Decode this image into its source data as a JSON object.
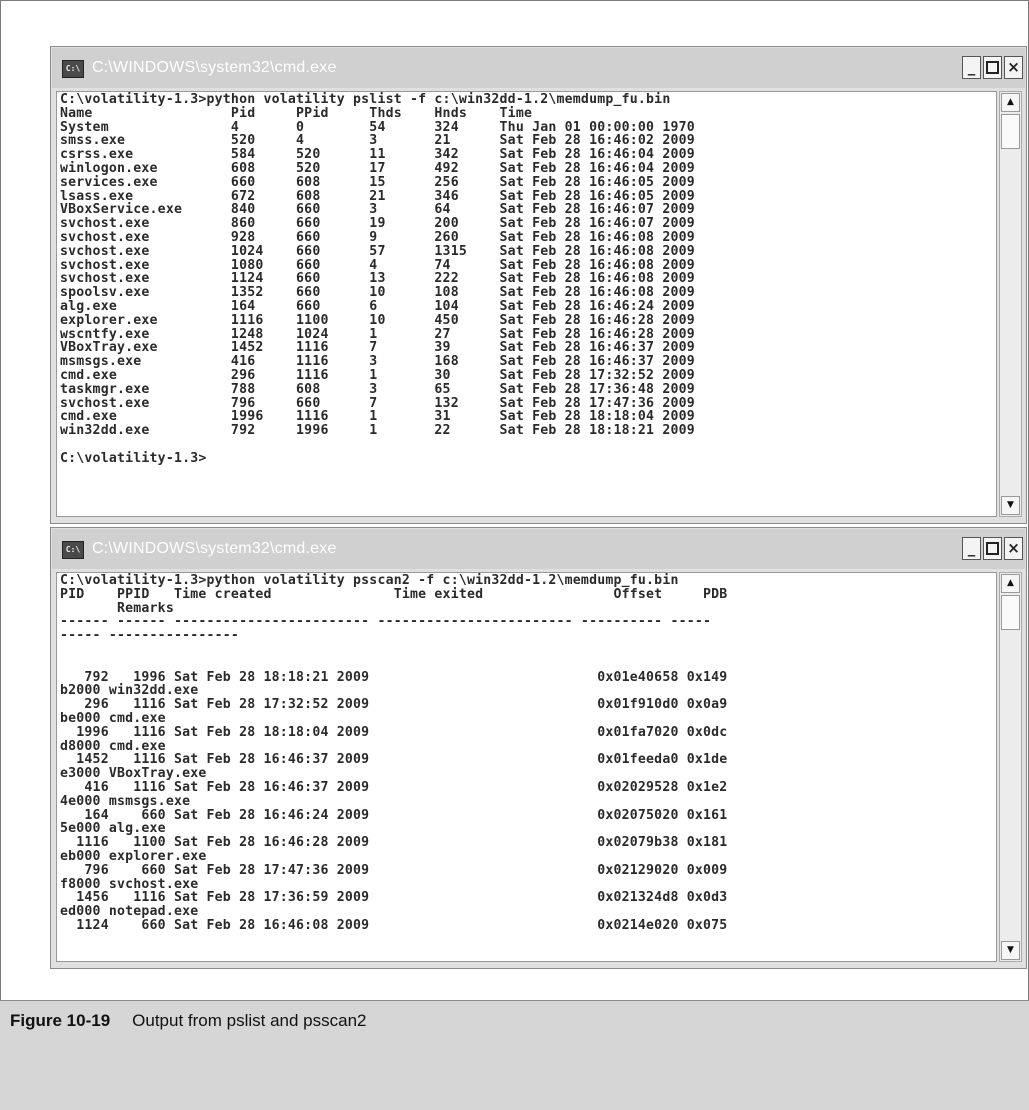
{
  "window1": {
    "title": "C:\\WINDOWS\\system32\\cmd.exe",
    "icon": "console-icon",
    "buttons": {
      "minimize": "_",
      "maximize": "□",
      "close": "×"
    },
    "output": "C:\\volatility-1.3>python volatility pslist -f c:\\win32dd-1.2\\memdump_fu.bin\nName                 Pid     PPid     Thds    Hnds    Time\nSystem               4       0        54      324     Thu Jan 01 00:00:00 1970\nsmss.exe             520     4        3       21      Sat Feb 28 16:46:02 2009\ncsrss.exe            584     520      11      342     Sat Feb 28 16:46:04 2009\nwinlogon.exe         608     520      17      492     Sat Feb 28 16:46:04 2009\nservices.exe         660     608      15      256     Sat Feb 28 16:46:05 2009\nlsass.exe            672     608      21      346     Sat Feb 28 16:46:05 2009\nVBoxService.exe      840     660      3       64      Sat Feb 28 16:46:07 2009\nsvchost.exe          860     660      19      200     Sat Feb 28 16:46:07 2009\nsvchost.exe          928     660      9       260     Sat Feb 28 16:46:08 2009\nsvchost.exe          1024    660      57      1315    Sat Feb 28 16:46:08 2009\nsvchost.exe          1080    660      4       74      Sat Feb 28 16:46:08 2009\nsvchost.exe          1124    660      13      222     Sat Feb 28 16:46:08 2009\nspoolsv.exe          1352    660      10      108     Sat Feb 28 16:46:08 2009\nalg.exe              164     660      6       104     Sat Feb 28 16:46:24 2009\nexplorer.exe         1116    1100     10      450     Sat Feb 28 16:46:28 2009\nwscntfy.exe          1248    1024     1       27      Sat Feb 28 16:46:28 2009\nVBoxTray.exe         1452    1116     7       39      Sat Feb 28 16:46:37 2009\nmsmsgs.exe           416     1116     3       168     Sat Feb 28 16:46:37 2009\ncmd.exe              296     1116     1       30      Sat Feb 28 17:32:52 2009\ntaskmgr.exe          788     608      3       65      Sat Feb 28 17:36:48 2009\nsvchost.exe          796     660      7       132     Sat Feb 28 17:47:36 2009\ncmd.exe              1996    1116     1       31      Sat Feb 28 18:18:04 2009\nwin32dd.exe          792     1996     1       22      Sat Feb 28 18:18:21 2009\n\nC:\\volatility-1.3>"
  },
  "window2": {
    "title": "C:\\WINDOWS\\system32\\cmd.exe",
    "icon": "console-icon",
    "buttons": {
      "minimize": "_",
      "maximize": "□",
      "close": "×"
    },
    "output": "C:\\volatility-1.3>python volatility psscan2 -f c:\\win32dd-1.2\\memdump_fu.bin\nPID    PPID   Time created               Time exited                Offset     PDB\n       Remarks\n------ ------ ------------------------ ------------------------ ---------- -----\n----- ----------------\n\n\n   792   1996 Sat Feb 28 18:18:21 2009                            0x01e40658 0x149\nb2000 win32dd.exe\n   296   1116 Sat Feb 28 17:32:52 2009                            0x01f910d0 0x0a9\nbe000 cmd.exe\n  1996   1116 Sat Feb 28 18:18:04 2009                            0x01fa7020 0x0dc\nd8000 cmd.exe\n  1452   1116 Sat Feb 28 16:46:37 2009                            0x01feeda0 0x1de\ne3000 VBoxTray.exe\n   416   1116 Sat Feb 28 16:46:37 2009                            0x02029528 0x1e2\n4e000 msmsgs.exe\n   164    660 Sat Feb 28 16:46:24 2009                            0x02075020 0x161\n5e000 alg.exe\n  1116   1100 Sat Feb 28 16:46:28 2009                            0x02079b38 0x181\neb000 explorer.exe\n   796    660 Sat Feb 28 17:47:36 2009                            0x02129020 0x009\nf8000 svchost.exe\n  1456   1116 Sat Feb 28 17:36:59 2009                            0x021324d8 0x0d3\ned000 notepad.exe\n  1124    660 Sat Feb 28 16:46:08 2009                            0x0214e020 0x075"
  },
  "caption": {
    "label": "Figure 10-19",
    "text": "Output from pslist and psscan2"
  }
}
